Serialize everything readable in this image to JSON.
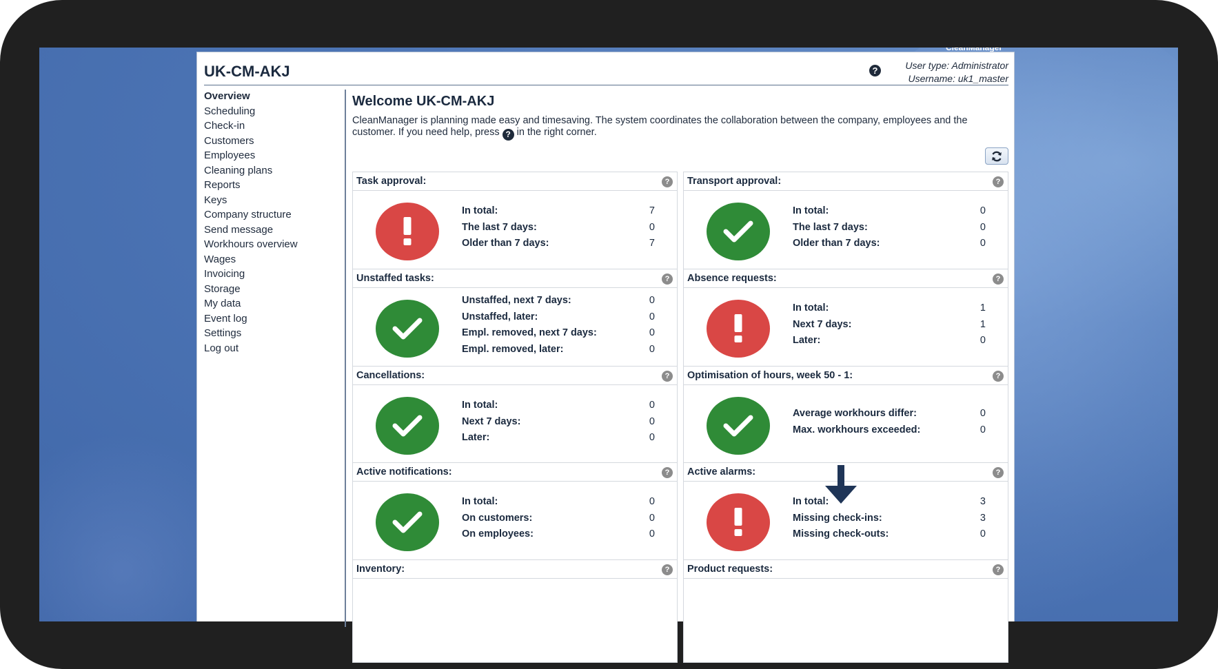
{
  "brand_top": "CleanManager",
  "header": {
    "title": "UK-CM-AKJ",
    "user_type": "User type: Administrator",
    "username": "Username: uk1_master"
  },
  "sidebar": {
    "items": [
      {
        "label": "Overview"
      },
      {
        "label": "Scheduling"
      },
      {
        "label": "Check-in"
      },
      {
        "label": "Customers"
      },
      {
        "label": "Employees"
      },
      {
        "label": "Cleaning plans"
      },
      {
        "label": "Reports"
      },
      {
        "label": "Keys"
      },
      {
        "label": "Company structure"
      },
      {
        "label": "Send message"
      },
      {
        "label": "Workhours overview"
      },
      {
        "label": "Wages"
      },
      {
        "label": "Invoicing"
      },
      {
        "label": "Storage"
      },
      {
        "label": "My data"
      },
      {
        "label": "Event log"
      },
      {
        "label": "Settings"
      },
      {
        "label": "Log out"
      }
    ]
  },
  "main": {
    "welcome": "Welcome UK-CM-AKJ",
    "intro_before": "CleanManager is planning made easy and timesaving. The system coordinates the collaboration between the company, employees and the customer. If you need help, press ",
    "intro_after": " in the right corner."
  },
  "panels": [
    {
      "title": "Task approval:",
      "status": "alert",
      "rows": [
        {
          "label": "In total:",
          "value": "7"
        },
        {
          "label": "The last 7 days:",
          "value": "0"
        },
        {
          "label": "Older than 7 days:",
          "value": "7"
        }
      ]
    },
    {
      "title": "Transport approval:",
      "status": "ok",
      "rows": [
        {
          "label": "In total:",
          "value": "0"
        },
        {
          "label": "The last 7 days:",
          "value": "0"
        },
        {
          "label": "Older than 7 days:",
          "value": "0"
        }
      ]
    },
    {
      "title": "Unstaffed tasks:",
      "status": "ok",
      "rows": [
        {
          "label": "Unstaffed, next 7 days:",
          "value": "0"
        },
        {
          "label": "Unstaffed, later:",
          "value": "0"
        },
        {
          "label": "Empl. removed, next 7 days:",
          "value": "0"
        },
        {
          "label": "Empl. removed, later:",
          "value": "0"
        }
      ]
    },
    {
      "title": "Absence requests:",
      "status": "alert",
      "rows": [
        {
          "label": "In total:",
          "value": "1"
        },
        {
          "label": "Next 7 days:",
          "value": "1"
        },
        {
          "label": "Later:",
          "value": "0"
        }
      ]
    },
    {
      "title": "Cancellations:",
      "status": "ok",
      "rows": [
        {
          "label": "In total:",
          "value": "0"
        },
        {
          "label": "Next 7 days:",
          "value": "0"
        },
        {
          "label": "Later:",
          "value": "0"
        }
      ]
    },
    {
      "title": "Optimisation of hours, week 50 - 1:",
      "status": "ok",
      "rows": [
        {
          "label": "Average workhours differ:",
          "value": "0"
        },
        {
          "label": "Max. workhours exceeded:",
          "value": "0"
        }
      ]
    },
    {
      "title": "Active notifications:",
      "status": "ok",
      "rows": [
        {
          "label": "In total:",
          "value": "0"
        },
        {
          "label": "On customers:",
          "value": "0"
        },
        {
          "label": "On employees:",
          "value": "0"
        }
      ]
    },
    {
      "title": "Active alarms:",
      "status": "alert",
      "rows": [
        {
          "label": "In total:",
          "value": "3"
        },
        {
          "label": "Missing check-ins:",
          "value": "3"
        },
        {
          "label": "Missing check-outs:",
          "value": "0"
        }
      ]
    },
    {
      "title": "Inventory:",
      "status": "",
      "rows": []
    },
    {
      "title": "Product requests:",
      "status": "",
      "rows": []
    }
  ],
  "icons": {
    "help": "?",
    "ok": "check-icon",
    "alert": "exclamation-icon",
    "refresh": "refresh-icon",
    "arrow": "down-arrow-icon"
  },
  "colors": {
    "ok": "#2f8b37",
    "alert": "#d94745",
    "arrow": "#1f3557"
  }
}
